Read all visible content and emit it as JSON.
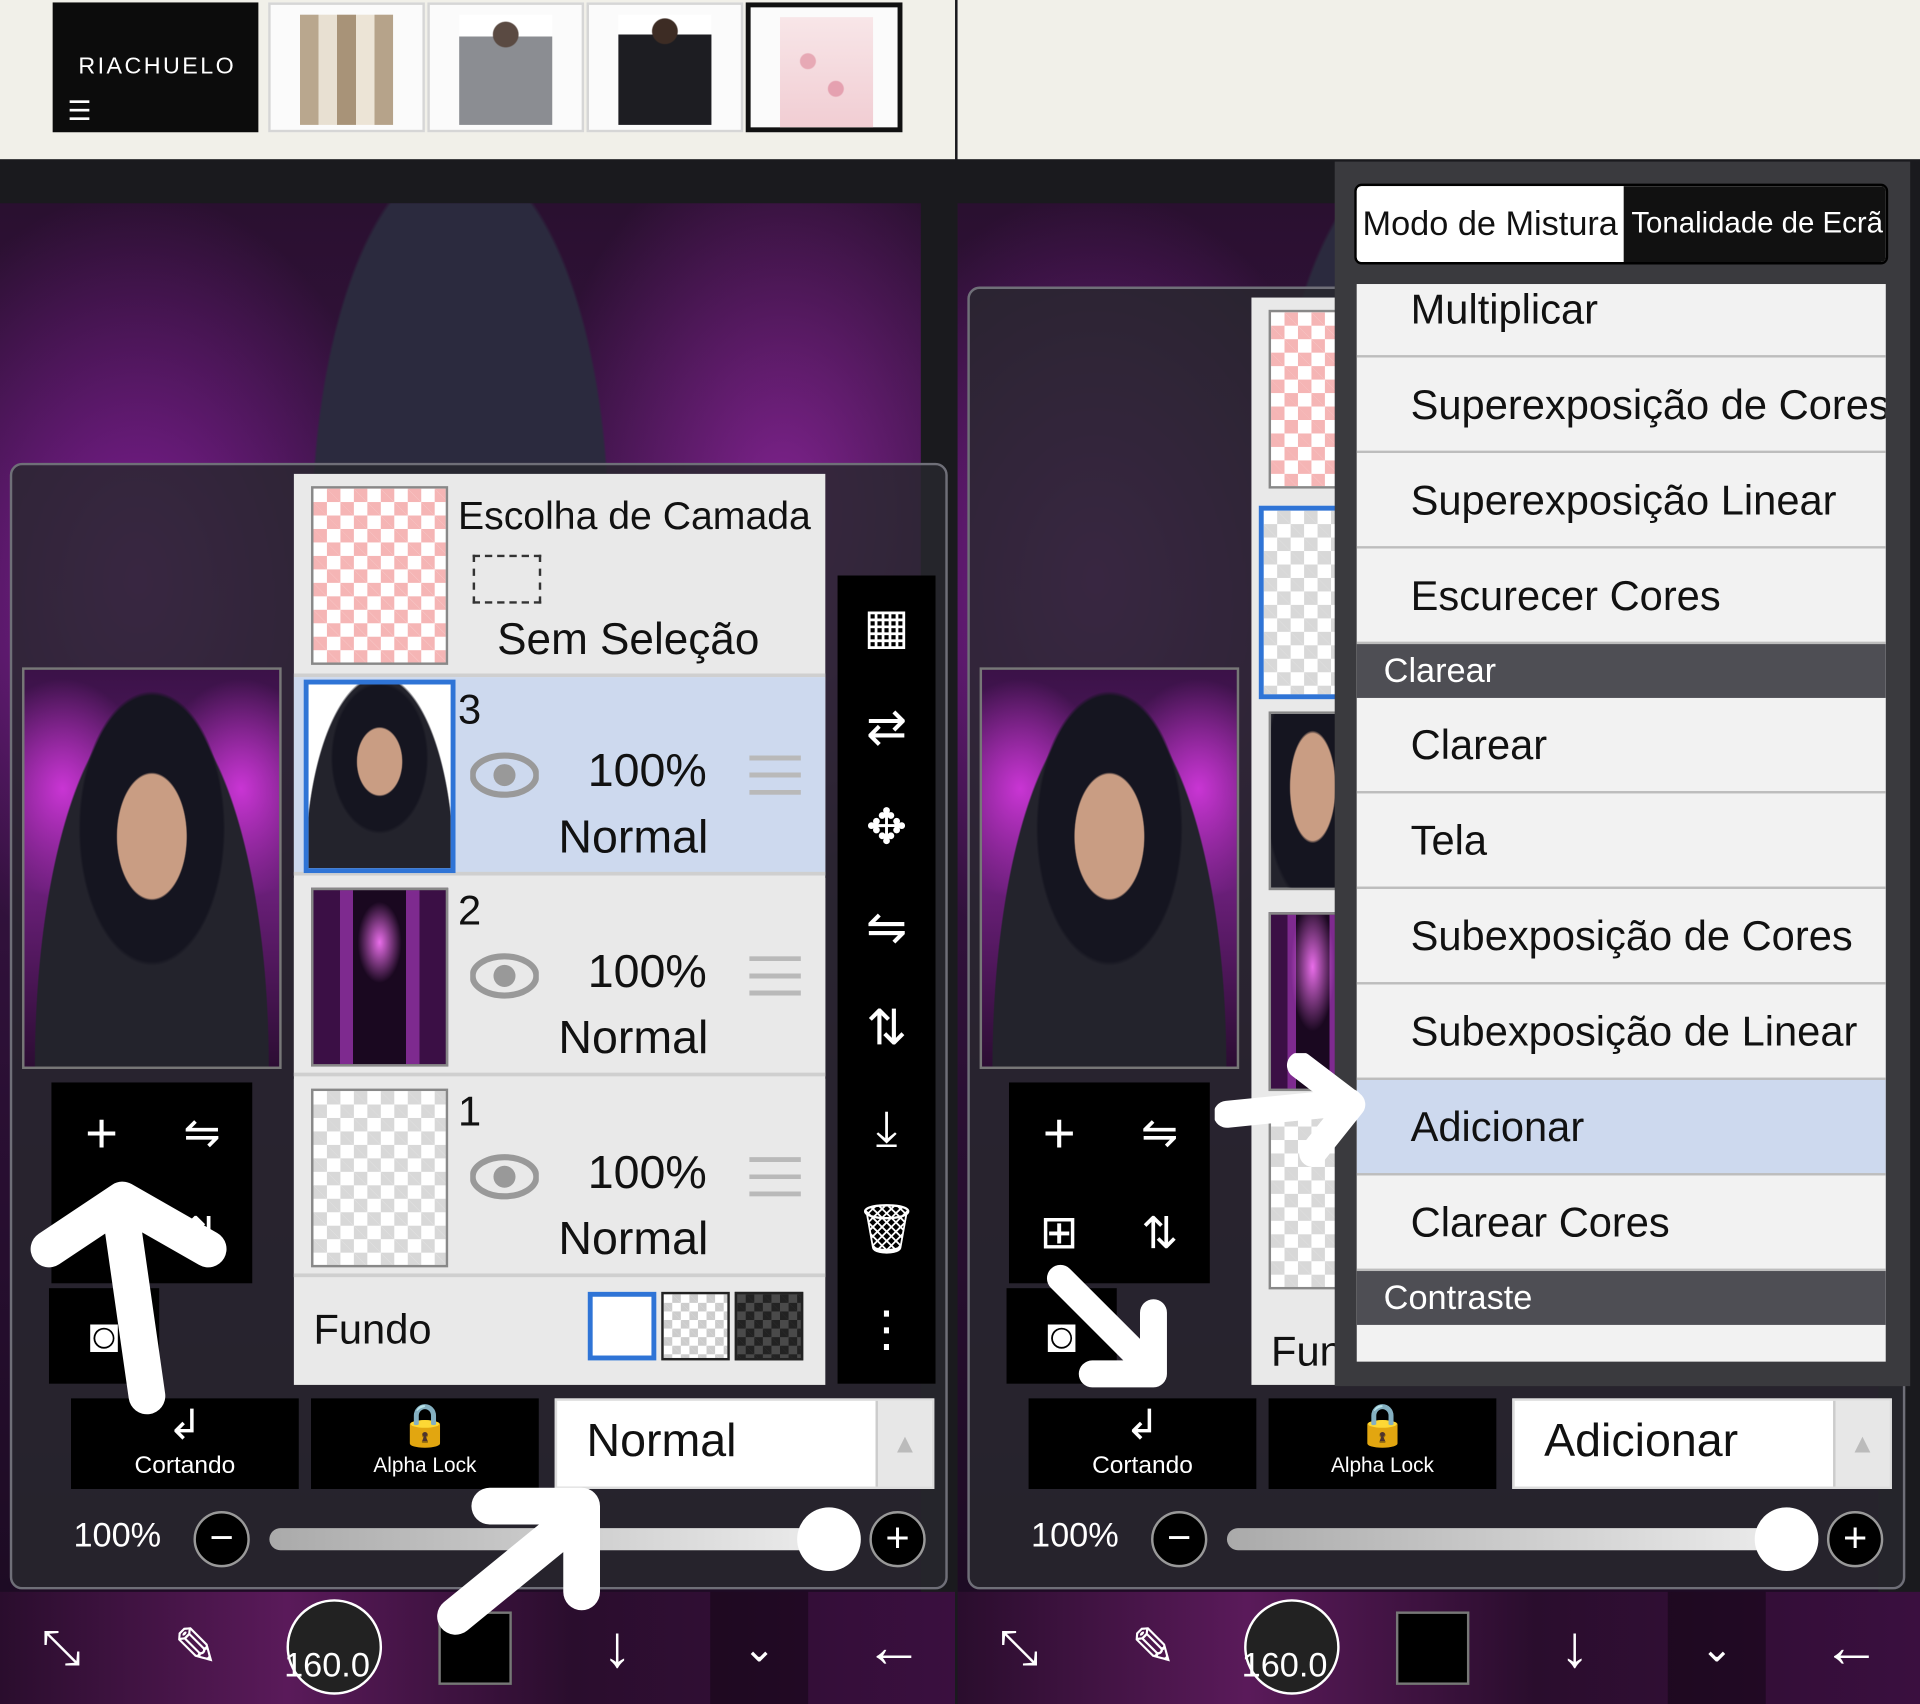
{
  "ad": {
    "brand": "RIACHUELO",
    "menu_icon": "hamburger-icon",
    "items": [
      "curtain",
      "woman-jacket",
      "woman-blazer",
      "bedding"
    ]
  },
  "left": {
    "layer_panel": {
      "selection_title": "Escolha de Camada",
      "selection_none": "Sem Seleção",
      "layers": [
        {
          "number": "3",
          "opacity": "100%",
          "mode": "Normal"
        },
        {
          "number": "2",
          "opacity": "100%",
          "mode": "Normal"
        },
        {
          "number": "1",
          "opacity": "100%",
          "mode": "Normal"
        }
      ],
      "background_label": "Fundo"
    },
    "controls": {
      "clipping_label": "Cortando",
      "alpha_lock_label": "Alpha Lock",
      "blend_mode": "Normal",
      "opacity": "100%"
    },
    "bottom": {
      "brush_size": "160.0"
    }
  },
  "right": {
    "dropdown": {
      "tab_blend": "Modo de Mistura",
      "tab_tone": "Tonalidade de Ecrã",
      "items": [
        {
          "label": "Multiplicar",
          "type": "item"
        },
        {
          "label": "Superexposição de Cores",
          "type": "item"
        },
        {
          "label": "Superexposição Linear",
          "type": "item"
        },
        {
          "label": "Escurecer Cores",
          "type": "item"
        },
        {
          "label": "Clarear",
          "type": "header"
        },
        {
          "label": "Clarear",
          "type": "item"
        },
        {
          "label": "Tela",
          "type": "item"
        },
        {
          "label": "Subexposição de Cores",
          "type": "item"
        },
        {
          "label": "Subexposição de Linear",
          "type": "item"
        },
        {
          "label": "Adicionar",
          "type": "item",
          "selected": true
        },
        {
          "label": "Clarear Cores",
          "type": "item"
        },
        {
          "label": "Contraste",
          "type": "header"
        }
      ]
    },
    "background_label_partial": "Fund",
    "controls": {
      "clipping_label": "Cortando",
      "alpha_lock_label": "Alpha Lock",
      "blend_mode": "Adicionar",
      "opacity": "100%"
    },
    "bottom": {
      "brush_size": "160.0"
    }
  },
  "colors": {
    "accent_blue": "#2f74d6",
    "selected_row": "#cdd9ee",
    "section_header": "#4e4e54"
  }
}
